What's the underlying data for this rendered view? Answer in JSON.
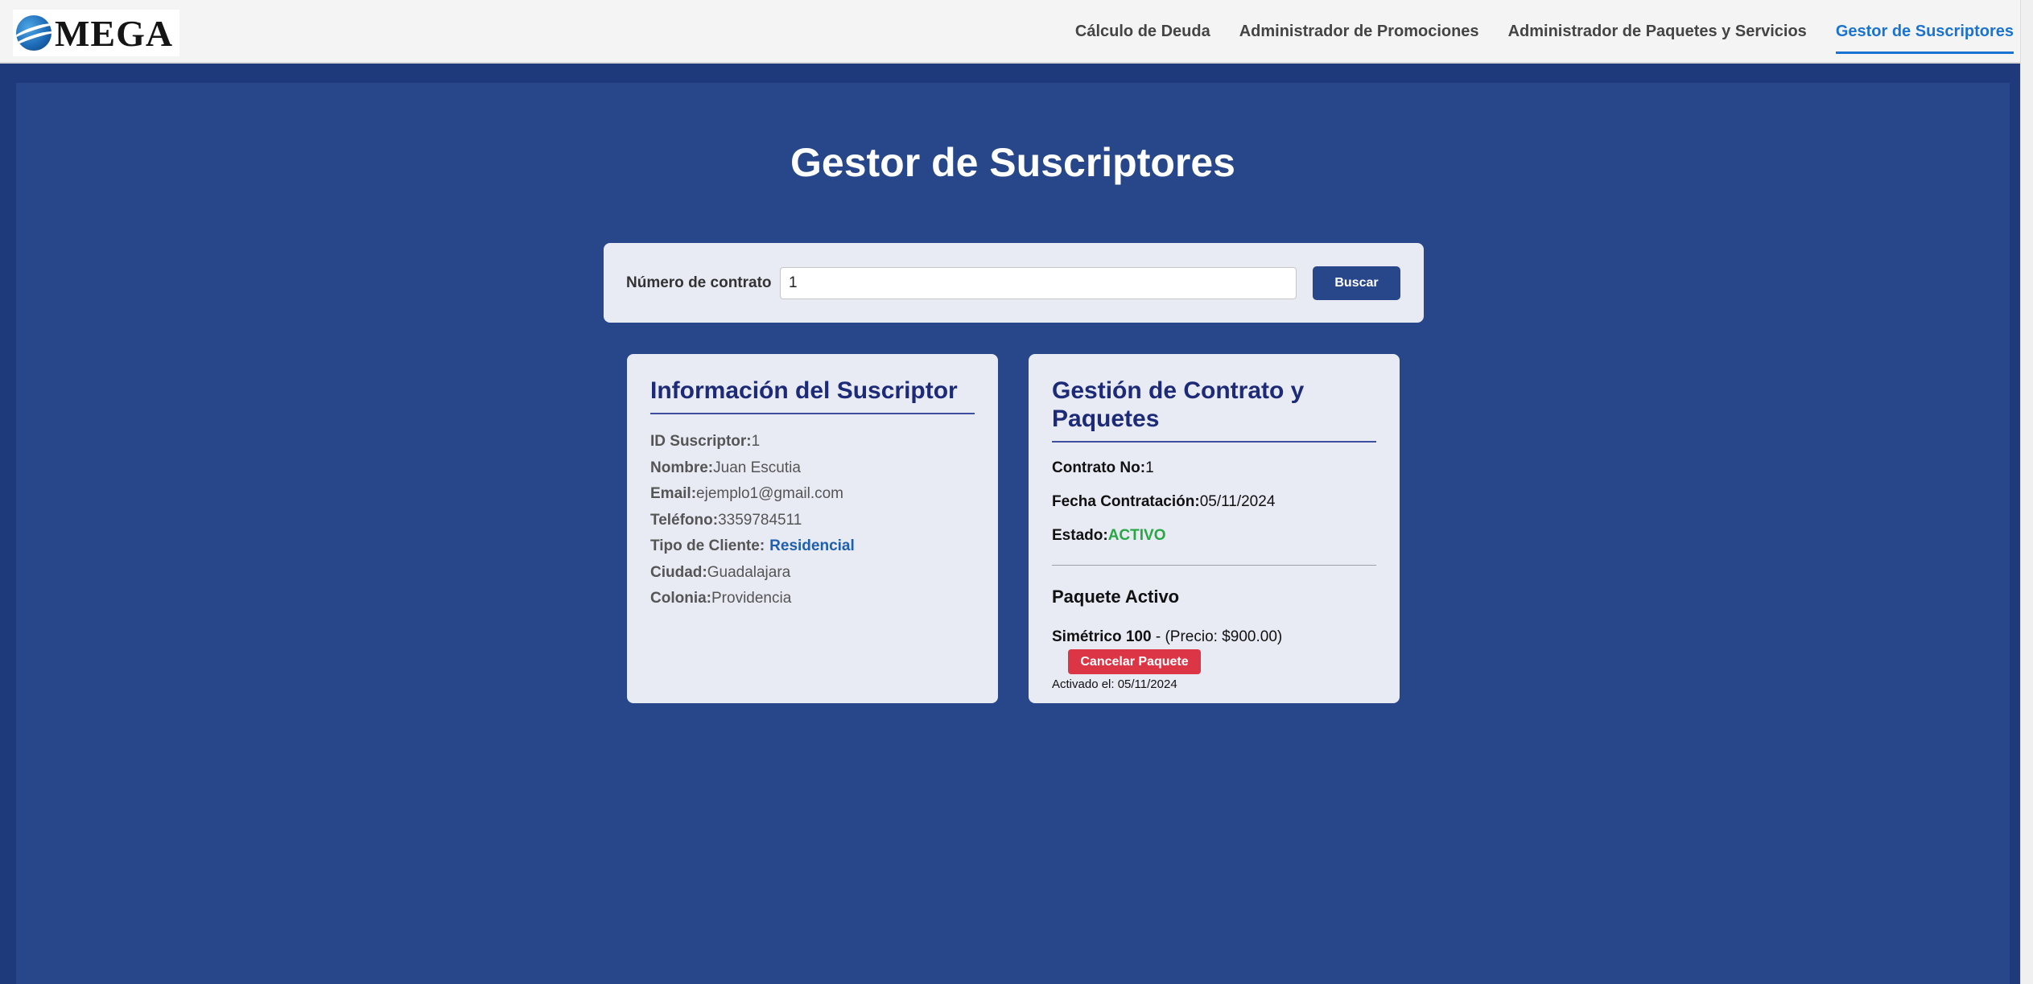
{
  "brand": {
    "logo_text": "MEGA"
  },
  "nav": {
    "items": [
      {
        "label": "Cálculo de Deuda"
      },
      {
        "label": "Administrador de Promociones"
      },
      {
        "label": "Administrador de Paquetes y Servicios"
      },
      {
        "label": "Gestor de Suscriptores"
      }
    ],
    "active": "Gestor de Suscriptores"
  },
  "page": {
    "title": "Gestor de Suscriptores"
  },
  "search": {
    "label": "Número de contrato",
    "value": "1",
    "button_label": "Buscar"
  },
  "subscriber": {
    "title": "Información del Suscriptor",
    "fields": [
      {
        "label": "ID Suscriptor:",
        "value": "1"
      },
      {
        "label": "Nombre:",
        "value": "Juan Escutia"
      },
      {
        "label": "Email:",
        "value": "ejemplo1@gmail.com"
      },
      {
        "label": "Teléfono:",
        "value": "3359784511"
      },
      {
        "label": "Tipo de Cliente:",
        "value": "Residencial"
      },
      {
        "label": "Ciudad:",
        "value": "Guadalajara"
      },
      {
        "label": "Colonia:",
        "value": "Providencia"
      }
    ]
  },
  "contract": {
    "title": "Gestión de Contrato y Paquetes",
    "number_label": "Contrato No:",
    "number": "1",
    "date_label": "Fecha Contratación:",
    "date": "05/11/2024",
    "status_label": "Estado:",
    "status": "ACTIVO",
    "package_heading": "Paquete Activo",
    "package_name": "Simétrico 100",
    "package_price": " - (Precio: $900.00)",
    "cancel_label": "Cancelar Paquete",
    "activated": "Activado el: 05/11/2024"
  },
  "colors": {
    "primary": "#27478a",
    "accent": "#1a73d1",
    "status_active": "#27a844",
    "danger": "#dc3545"
  }
}
